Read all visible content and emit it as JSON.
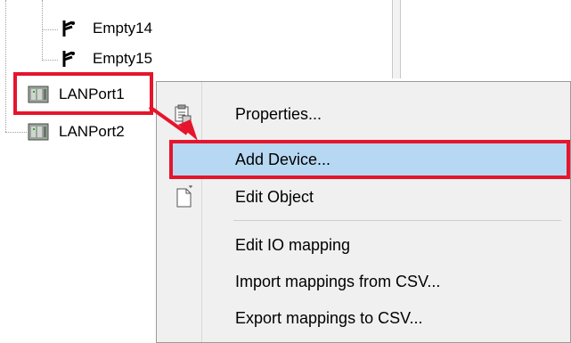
{
  "tree": {
    "items": [
      {
        "label": "Empty14",
        "icon": "connector-icon"
      },
      {
        "label": "Empty15",
        "icon": "connector-icon"
      },
      {
        "label": "LANPort1",
        "icon": "lan-port-icon"
      },
      {
        "label": "LANPort2",
        "icon": "lan-port-icon"
      }
    ]
  },
  "context_menu": {
    "items": [
      {
        "label": "Properties...",
        "icon": "properties-icon"
      },
      {
        "label": "Add Device...",
        "selected": true
      },
      {
        "label": "Edit Object",
        "icon": "edit-object-icon"
      },
      {
        "label": "Edit IO mapping"
      },
      {
        "label": "Import mappings from CSV..."
      },
      {
        "label": "Export mappings to CSV..."
      }
    ]
  },
  "colors": {
    "highlight_border": "#e5152c",
    "selected_background": "#b7d8f2",
    "menu_background": "#f0f0f0"
  }
}
